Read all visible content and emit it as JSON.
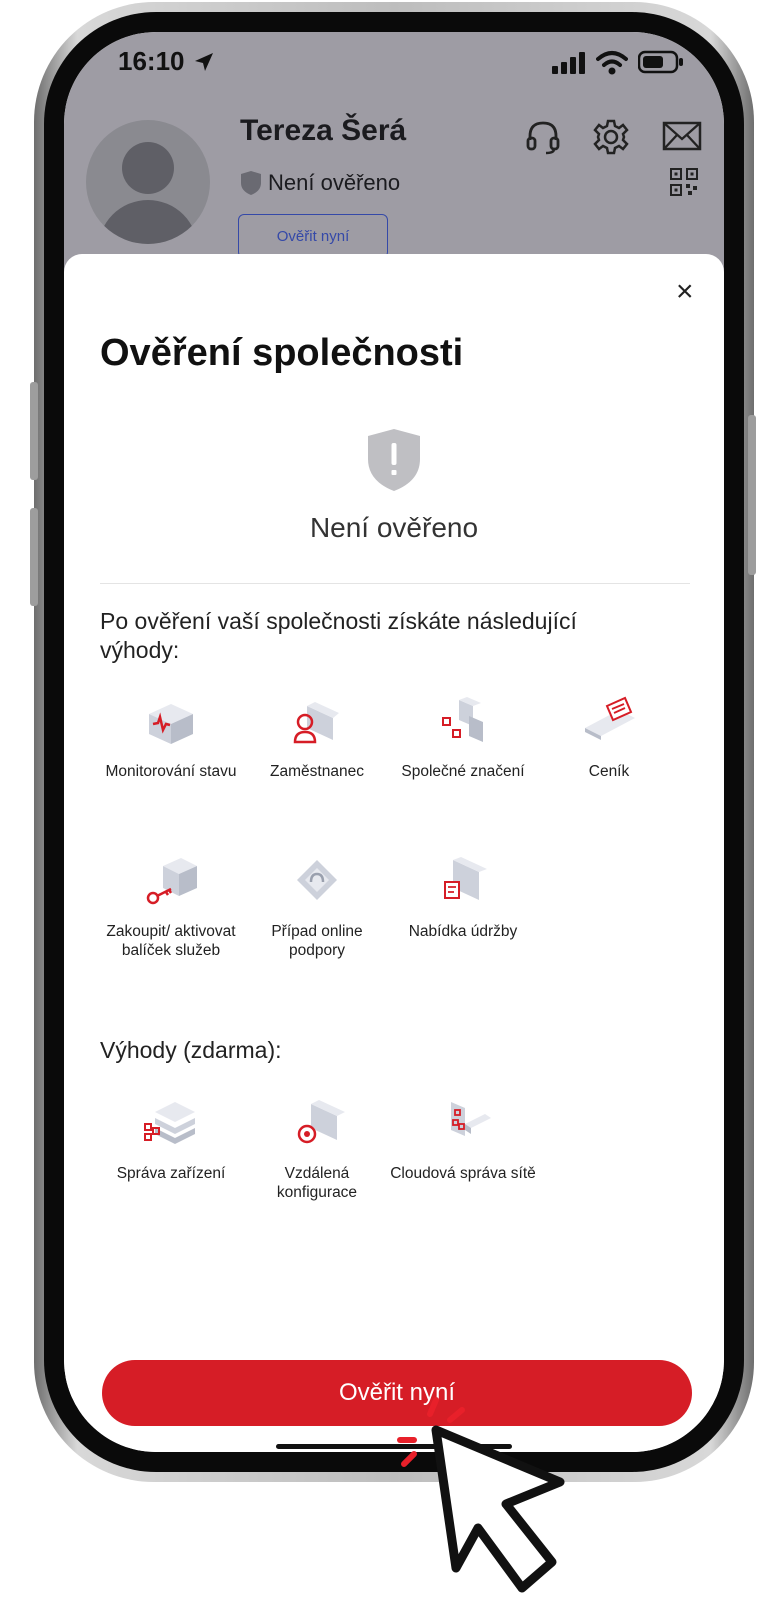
{
  "status_bar": {
    "time": "16:10"
  },
  "profile": {
    "name": "Tereza Šerá",
    "verification_status": "Není ověřeno",
    "verify_button": "Ověřit nyní"
  },
  "modal": {
    "close_label": "×",
    "title": "Ověření společnosti",
    "status_label": "Není ověřeno",
    "intro_text": "Po ověření vaší společnosti získáte následující výhody:",
    "benefits": [
      {
        "label": "Monitorování stavu",
        "icon": "monitoring-icon"
      },
      {
        "label": "Zaměstnanec",
        "icon": "employee-icon"
      },
      {
        "label": "Společné značení",
        "icon": "co-branding-icon"
      },
      {
        "label": "Ceník",
        "icon": "pricelist-icon"
      },
      {
        "label": "Zakoupit/ aktivovat balíček služeb",
        "icon": "service-package-icon"
      },
      {
        "label": "Případ online podpory",
        "icon": "online-support-icon"
      },
      {
        "label": "Nabídka údržby",
        "icon": "maintenance-offer-icon"
      }
    ],
    "free_section_title": "Výhody (zdarma):",
    "free_benefits": [
      {
        "label": "Správa zařízení",
        "icon": "device-management-icon"
      },
      {
        "label": "Vzdálená konfigurace",
        "icon": "remote-config-icon"
      },
      {
        "label": "Cloudová správa sítě",
        "icon": "cloud-network-icon"
      }
    ],
    "cta_label": "Ověřit nyní"
  },
  "colors": {
    "accent": "#d61d26",
    "link": "#3549a8",
    "overlay": "#9e9ca4"
  }
}
